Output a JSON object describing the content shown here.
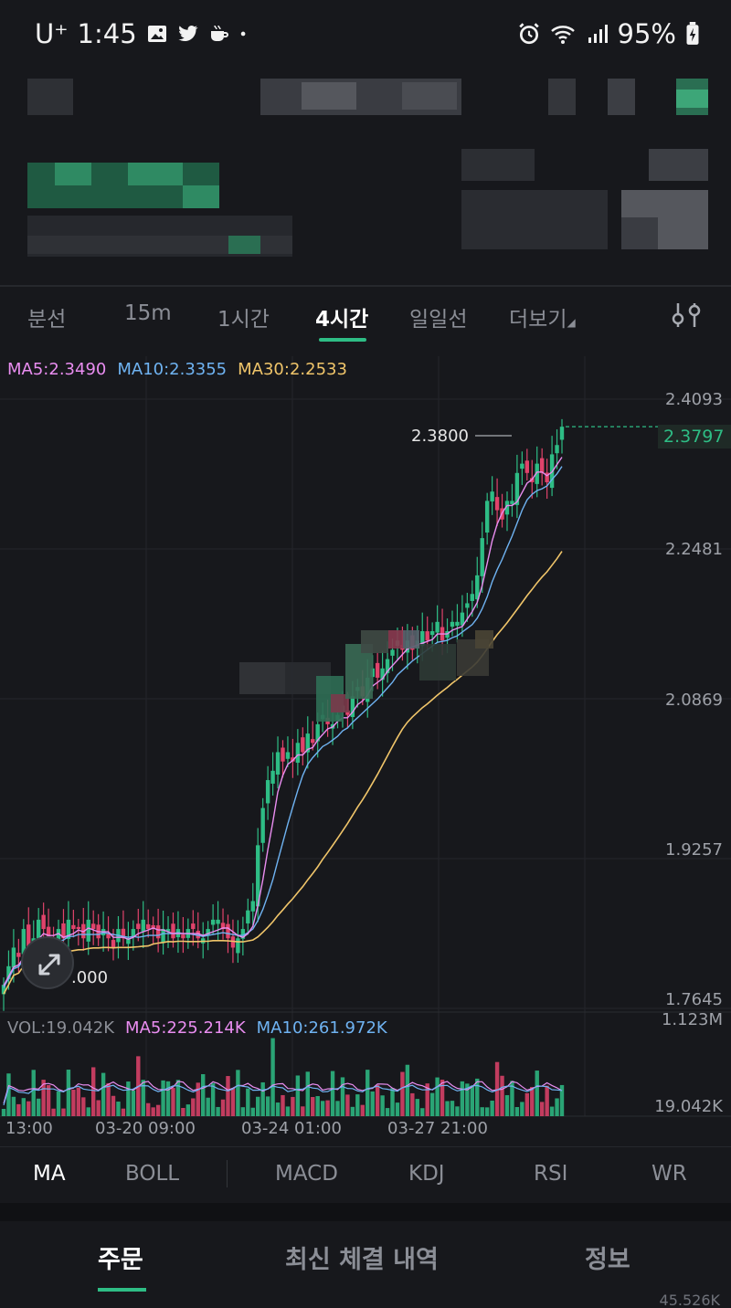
{
  "status_bar": {
    "carrier": "U⁺",
    "time": "1:45",
    "battery": "95%"
  },
  "interval_tabs": [
    {
      "label": "분선"
    },
    {
      "label": "15m"
    },
    {
      "label": "1시간"
    },
    {
      "label": "4시간"
    },
    {
      "label": "일일선"
    },
    {
      "label": "더보기"
    }
  ],
  "ma_legend": {
    "ma5": "MA5:2.3490",
    "ma10": "MA10:2.3355",
    "ma30": "MA30:2.2533"
  },
  "price_axis": [
    "2.4093",
    "2.2481",
    "2.0869",
    "1.9257",
    "1.7645"
  ],
  "last_price": "2.3797",
  "high_marker": "2.3800",
  "low_marker": ".000",
  "volume_legend": {
    "vol": "VOL:19.042K",
    "ma5": "MA5:225.214K",
    "ma10": "MA10:261.972K"
  },
  "volume_axis": {
    "max": "1.123M",
    "current": "19.042K"
  },
  "time_axis": [
    "13:00",
    "03-20 09:00",
    "03-24 01:00",
    "03-27 21:00"
  ],
  "indicator_tabs": [
    {
      "label": "MA"
    },
    {
      "label": "BOLL"
    },
    {
      "label": "MACD"
    },
    {
      "label": "KDJ"
    },
    {
      "label": "RSI"
    },
    {
      "label": "WR"
    }
  ],
  "bottom_tabs": [
    {
      "label": "주문"
    },
    {
      "label": "최신 체결 내역"
    },
    {
      "label": "정보"
    }
  ],
  "bottom_number": "45.526K",
  "colors": {
    "up": "#2ebd85",
    "down": "#e0436b",
    "ma5": "#e98df0",
    "ma10": "#6fb3f2",
    "ma30": "#f0c56a",
    "background": "#17181c"
  },
  "chart_data": {
    "type": "candlestick",
    "ylim": [
      1.7645,
      2.4093
    ],
    "price_ticks": [
      2.4093,
      2.2481,
      2.0869,
      1.9257,
      1.7645
    ],
    "x_ticks": [
      "13:00",
      "03-20 09:00",
      "03-24 01:00",
      "03-27 21:00"
    ],
    "close_approx": [
      1.78,
      1.8,
      1.82,
      1.81,
      1.84,
      1.82,
      1.83,
      1.85,
      1.84,
      1.83,
      1.82,
      1.84,
      1.83,
      1.85,
      1.84,
      1.84,
      1.83,
      1.85,
      1.84,
      1.83,
      1.84,
      1.83,
      1.82,
      1.84,
      1.83,
      1.83,
      1.84,
      1.84,
      1.85,
      1.84,
      1.84,
      1.83,
      1.84,
      1.84,
      1.83,
      1.84,
      1.83,
      1.84,
      1.84,
      1.83,
      1.83,
      1.84,
      1.85,
      1.85,
      1.84,
      1.83,
      1.82,
      1.83,
      1.84,
      1.86,
      1.87,
      1.93,
      1.97,
      2.0,
      2.01,
      2.03,
      2.02,
      2.03,
      2.02,
      2.04,
      2.03,
      2.05,
      2.04,
      2.06,
      2.07,
      2.06,
      2.06,
      2.07,
      2.08,
      2.07,
      2.09,
      2.1,
      2.09,
      2.11,
      2.12,
      2.11,
      2.12,
      2.13,
      2.14,
      2.15,
      2.14,
      2.15,
      2.14,
      2.15,
      2.16,
      2.15,
      2.16,
      2.17,
      2.15,
      2.16,
      2.17,
      2.17,
      2.18,
      2.19,
      2.2,
      2.22,
      2.26,
      2.3,
      2.31,
      2.29,
      2.28,
      2.3,
      2.3,
      2.33,
      2.34,
      2.33,
      2.32,
      2.34,
      2.33,
      2.32,
      2.35,
      2.36,
      2.3797
    ],
    "ma5_last": 2.349,
    "ma10_last": 2.3355,
    "ma30_last": 2.2533,
    "volume_max": "1.123M",
    "volume_last": "19.042K"
  }
}
